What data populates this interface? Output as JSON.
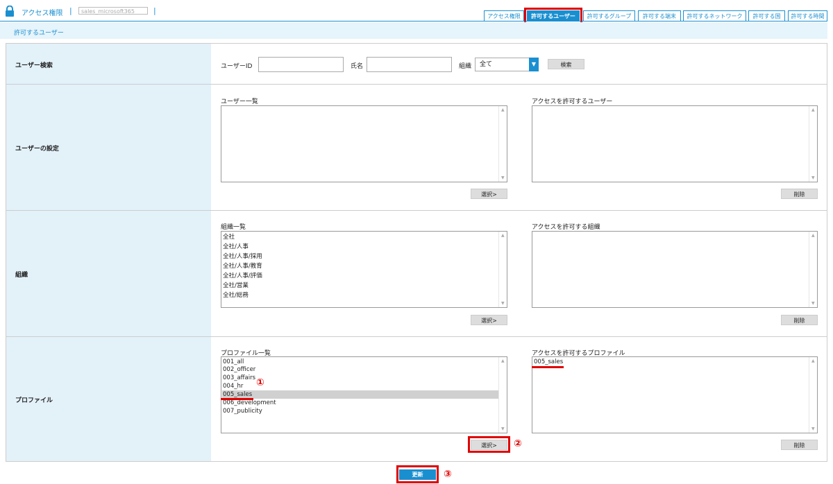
{
  "header": {
    "title": "アクセス権限",
    "separator": "|",
    "account": "sales_microsoft365",
    "tabs": [
      "アクセス権限",
      "許可するユーザー",
      "許可するグループ",
      "許可する端末",
      "許可するネットワーク",
      "許可する国",
      "許可する時間"
    ],
    "active_tab": "許可するユーザー"
  },
  "subheader": {
    "title": "許可するユーザー"
  },
  "user_search": {
    "label": "ユーザー検索",
    "user_id_label": "ユーザーID",
    "user_id_value": "",
    "name_label": "氏名",
    "name_value": "",
    "org_label": "組織",
    "org_value": "全て",
    "search_button": "検索"
  },
  "user_settings": {
    "label": "ユーザーの設定",
    "list_label": "ユーザー一覧",
    "allowed_label": "アクセスを許可するユーザー",
    "list_items": [],
    "allowed_items": [],
    "select_button": "選択>",
    "delete_button": "削除"
  },
  "organization": {
    "label": "組織",
    "list_label": "組織一覧",
    "allowed_label": "アクセスを許可する組織",
    "list_items": [
      "全社",
      "全社/人事",
      "全社/人事/採用",
      "全社/人事/教育",
      "全社/人事/評価",
      "全社/営業",
      "全社/総務"
    ],
    "allowed_items": [],
    "select_button": "選択>",
    "delete_button": "削除"
  },
  "profile": {
    "label": "プロファイル",
    "list_label": "プロファイル一覧",
    "allowed_label": "アクセスを許可するプロファイル",
    "list_items": [
      "001_all",
      "002_officer",
      "003_affairs",
      "004_hr",
      "005_sales",
      "006_development",
      "007_publicity"
    ],
    "selected_item": "005_sales",
    "allowed_items": [
      "005_sales"
    ],
    "select_button": "選択>",
    "delete_button": "削除"
  },
  "update_button": "更新",
  "annotations": {
    "step1": "①",
    "step2": "②",
    "step3": "③"
  },
  "colors": {
    "accent": "#1a8fd0",
    "label_bg": "#e3f1f9",
    "highlight": "#e00000"
  }
}
